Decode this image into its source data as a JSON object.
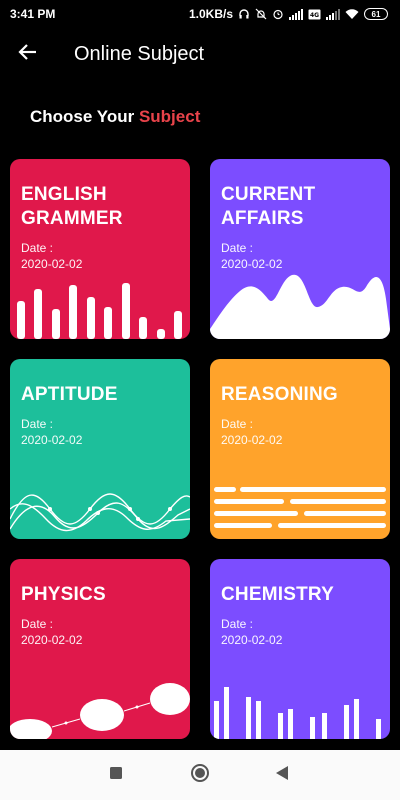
{
  "status_bar": {
    "time": "3:41 PM",
    "speed": "1.0KB/s",
    "battery": "61"
  },
  "app_bar": {
    "title": "Online Subject",
    "back_icon": "arrow-left-icon"
  },
  "heading": {
    "prefix": "Choose Your",
    "accent": "Subject"
  },
  "subjects": [
    {
      "title_line1": "ENGLISH",
      "title_line2": "GRAMMER",
      "date_label": "Date :",
      "date": "2020-02-02",
      "color": "#e0184b"
    },
    {
      "title_line1": "CURRENT",
      "title_line2": "AFFAIRS",
      "date_label": "Date :",
      "date": "2020-02-02",
      "color": "#7c4dff"
    },
    {
      "title_line1": "APTITUDE",
      "title_line2": "",
      "date_label": "Date :",
      "date": "2020-02-02",
      "color": "#1dbf9b"
    },
    {
      "title_line1": "REASONING",
      "title_line2": "",
      "date_label": "Date :",
      "date": "2020-02-02",
      "color": "#ffa32b"
    },
    {
      "title_line1": "PHYSICS",
      "title_line2": "",
      "date_label": "Date :",
      "date": "2020-02-02",
      "color": "#e0184b"
    },
    {
      "title_line1": "CHEMISTRY",
      "title_line2": "",
      "date_label": "Date :",
      "date": "2020-02-02",
      "color": "#7c4dff"
    }
  ],
  "nav": {
    "recent_icon": "square-icon",
    "home_icon": "circle-icon",
    "back_icon": "triangle-back-icon"
  }
}
